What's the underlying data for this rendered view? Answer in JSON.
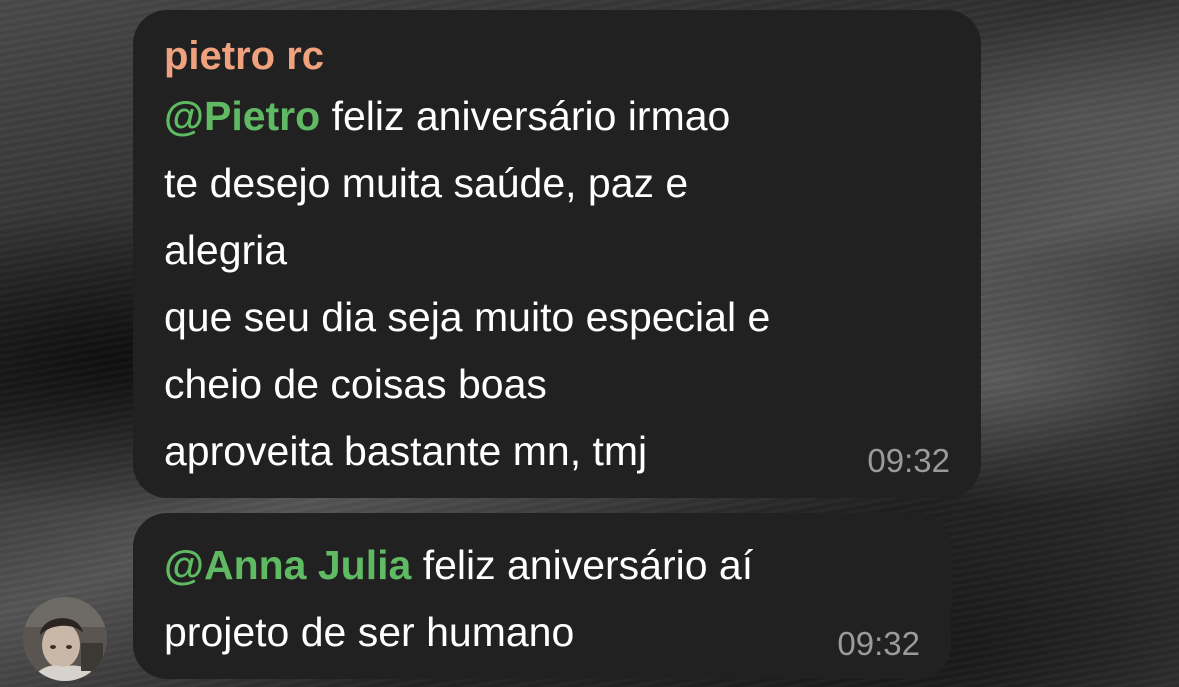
{
  "messages": [
    {
      "sender": "pietro rc",
      "mention": "@Pietro",
      "lines": [
        " feliz aniversário irmao",
        "te desejo muita saúde, paz e",
        "alegria",
        "que seu dia seja muito especial e",
        "cheio de coisas boas",
        "aproveita bastante mn, tmj"
      ],
      "time": "09:32"
    },
    {
      "mention": "@Anna Julia",
      "lines": [
        " feliz aniversário aí",
        "projeto de ser humano"
      ],
      "time": "09:32"
    }
  ],
  "avatar": {
    "icon": "user-photo-avatar"
  },
  "colors": {
    "bubble": "#212121",
    "sender_name": "#f0a27f",
    "mention": "#5fba63",
    "timestamp": "#9b9b9b",
    "text": "#ffffff"
  }
}
